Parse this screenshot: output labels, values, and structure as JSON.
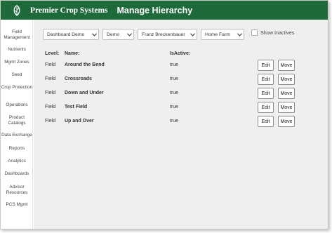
{
  "header": {
    "brand": "Premier Crop Systems",
    "title": "Manage Hierarchy"
  },
  "sidebar": {
    "items": [
      {
        "label": "Field Management"
      },
      {
        "label": "Nutrients"
      },
      {
        "label": "Mgmt Zones"
      },
      {
        "label": "Seed"
      },
      {
        "label": "Crop Protection"
      },
      {
        "label": "Operations"
      },
      {
        "label": "Product Catalogs"
      },
      {
        "label": "Data Exchange"
      },
      {
        "label": "Reports"
      },
      {
        "label": "Analytics"
      },
      {
        "label": "Dashboards"
      },
      {
        "label": "Advisor Resources"
      },
      {
        "label": "PCS Mgmt"
      }
    ]
  },
  "filters": {
    "org": "Dashboard Demo",
    "grower": "Demo",
    "person": "Franz Breckenbauer",
    "farm": "Home Farm",
    "show_inactives_label": "Show Inactives"
  },
  "table": {
    "headers": {
      "level": "Level:",
      "name": "Name:",
      "active": "IsActive:"
    },
    "rows": [
      {
        "level": "Field",
        "name": "Around the Bend",
        "active": "true",
        "edit": "Edit",
        "move": "Move"
      },
      {
        "level": "Field",
        "name": "Crossroads",
        "active": "true",
        "edit": "Edit",
        "move": "Move"
      },
      {
        "level": "Field",
        "name": "Down and Under",
        "active": "true",
        "edit": "Edit",
        "move": "Move"
      },
      {
        "level": "Field",
        "name": "Test Field",
        "active": "true",
        "edit": "Edit",
        "move": "Move"
      },
      {
        "level": "Field",
        "name": "Up and Over",
        "active": "true",
        "edit": "Edit",
        "move": "Move"
      }
    ]
  },
  "colors": {
    "header_bg": "#1e6a3b",
    "content_bg": "#efefef"
  },
  "icons": {
    "logo": "leaf-logo-icon",
    "dropdown": "chevron-down-icon"
  }
}
